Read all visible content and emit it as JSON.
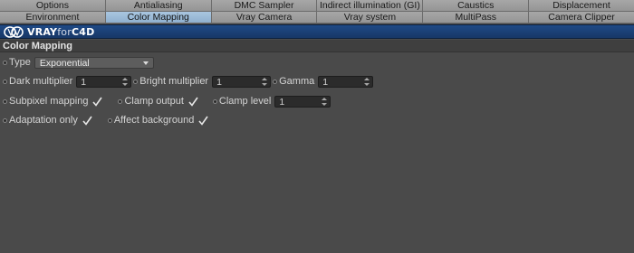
{
  "tabs": {
    "row1": [
      "Options",
      "Antialiasing",
      "DMC Sampler",
      "Indirect illumination (GI)",
      "Caustics",
      "Displacement"
    ],
    "row2": [
      "Environment",
      "Color Mapping",
      "Vray Camera",
      "Vray system",
      "MultiPass",
      "Camera Clipper"
    ],
    "active": "Color Mapping"
  },
  "brand": {
    "bold": "VRAY",
    "thin": "for",
    "suffix": "C4D"
  },
  "section": {
    "title": "Color Mapping"
  },
  "fields": {
    "type": {
      "label": "Type",
      "value": "Exponential"
    },
    "dark_multiplier": {
      "label": "Dark multiplier",
      "value": "1"
    },
    "bright_multiplier": {
      "label": "Bright multiplier",
      "value": "1"
    },
    "gamma": {
      "label": "Gamma",
      "value": "1"
    },
    "subpixel_mapping": {
      "label": "Subpixel mapping",
      "checked": true
    },
    "clamp_output": {
      "label": "Clamp output",
      "checked": true
    },
    "clamp_level": {
      "label": "Clamp level",
      "value": "1"
    },
    "adaptation_only": {
      "label": "Adaptation only",
      "checked": true
    },
    "affect_background": {
      "label": "Affect background",
      "checked": true
    }
  },
  "colors": {
    "active_tab": "#9dbcd9",
    "brand_bar": "#1d4278",
    "panel": "#4a4a4a"
  }
}
